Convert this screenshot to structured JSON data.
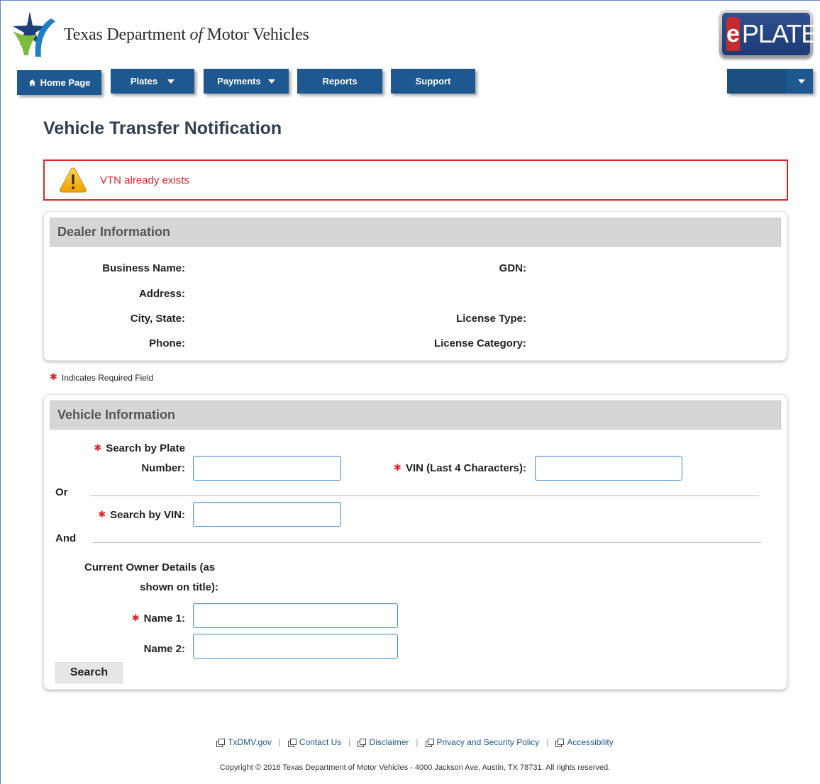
{
  "header": {
    "agency_title_prefix": "Texas Department",
    "agency_title_of": "of",
    "agency_title_suffix": "Motor Vehicles",
    "eplate_e": "e",
    "eplate_word": "PLATE"
  },
  "nav": {
    "home": "Home Page",
    "plates": "Plates",
    "payments": "Payments",
    "reports": "Reports",
    "support": "Support"
  },
  "page_title": "Vehicle Transfer Notification",
  "alert": {
    "message": "VTN already exists",
    "icon": "warning-icon"
  },
  "dealer": {
    "header": "Dealer Information",
    "business_name_label": "Business Name:",
    "address_label": "Address:",
    "city_state_label": "City, State:",
    "phone_label": "Phone:",
    "gdn_label": "GDN:",
    "license_type_label": "License Type:",
    "license_category_label": "License Category:"
  },
  "required_note": "Indicates Required Field",
  "required_marker": "✱",
  "vehicle": {
    "header": "Vehicle Information",
    "search_by_plate_label": "Search by Plate",
    "number_label": "Number:",
    "vin_last4_label": "VIN (Last 4 Characters):",
    "or_label": "Or",
    "search_by_vin_label": "Search by VIN:",
    "and_label": "And",
    "owner_details_line1": "Current Owner Details (as",
    "owner_details_line2": "shown on title):",
    "name1_label": "Name 1:",
    "name2_label": "Name 2:",
    "search_button": "Search"
  },
  "footer": {
    "links": [
      "TxDMV.gov",
      "Contact Us",
      "Disclaimer",
      "Privacy and Security Policy",
      "Accessibility"
    ],
    "copyright": "Copyright © 2016 Texas Department of Motor Vehicles - 4000 Jackson Ave, Austin, TX 78731. All rights reserved."
  },
  "colors": {
    "nav_blue": "#1d5990",
    "alert_red": "#e0232a",
    "panel_header_gray": "#d6d6d6"
  }
}
